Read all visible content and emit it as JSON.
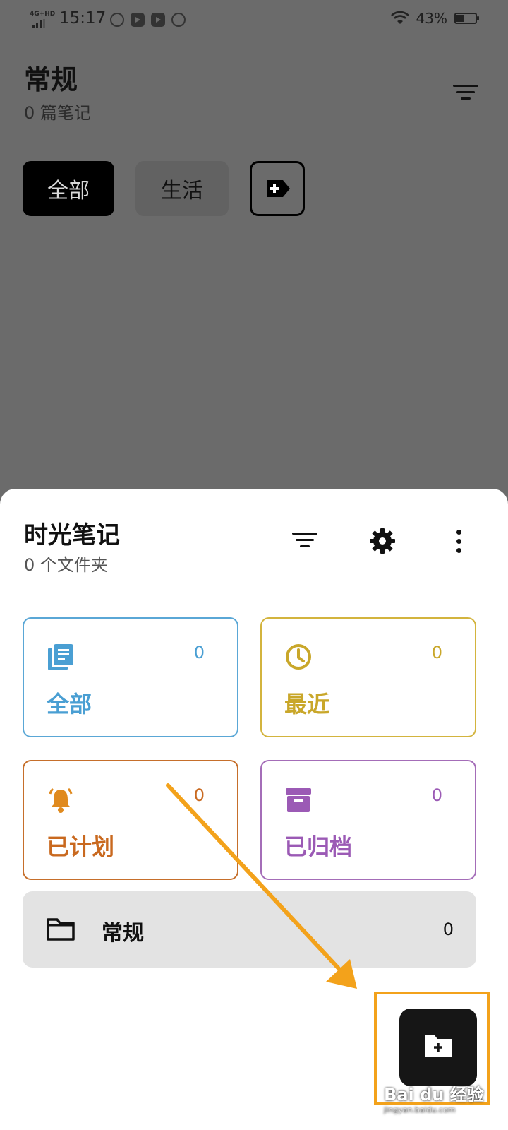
{
  "status_bar": {
    "network": "4G+HD",
    "time": "15:17",
    "battery": "43%",
    "battery_level": 0.43
  },
  "header": {
    "title": "常规",
    "subtitle": "0 篇笔记"
  },
  "chips": [
    {
      "label": "全部",
      "active": true
    },
    {
      "label": "生活",
      "active": false
    }
  ],
  "sheet": {
    "title": "时光笔记",
    "subtitle": "0 个文件夹",
    "cards": [
      {
        "label": "全部",
        "count": "0",
        "icon": "notes-stack-icon",
        "color": "#4a9fd3"
      },
      {
        "label": "最近",
        "count": "0",
        "icon": "clock-icon",
        "color": "#c9a72a"
      },
      {
        "label": "已计划",
        "count": "0",
        "icon": "bell-icon",
        "color": "#c9691f"
      },
      {
        "label": "已归档",
        "count": "0",
        "icon": "archive-box-icon",
        "color": "#9b5ab5"
      }
    ],
    "folders": [
      {
        "name": "常规",
        "count": "0",
        "icon": "folder-icon"
      }
    ]
  },
  "annotation": {
    "color": "#f3a21b"
  },
  "watermark": {
    "main": "Bai du 经验",
    "sub": "jingyan.baidu.com"
  }
}
